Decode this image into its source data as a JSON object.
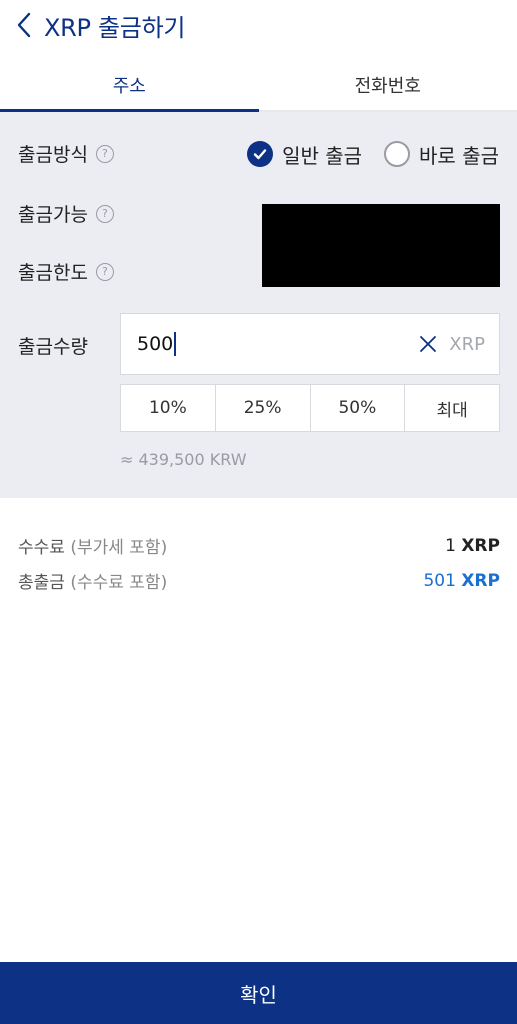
{
  "header": {
    "title": "XRP 출금하기"
  },
  "tabs": [
    {
      "label": "주소",
      "active": true
    },
    {
      "label": "전화번호",
      "active": false
    }
  ],
  "form": {
    "method_label": "출금방식",
    "options": [
      {
        "label": "일반 출금",
        "selected": true
      },
      {
        "label": "바로 출금",
        "selected": false
      }
    ],
    "available_label": "출금가능",
    "limit_label": "출금한도",
    "amount_label": "출금수량",
    "amount_value": "500",
    "amount_unit": "XRP",
    "percent_buttons": [
      "10%",
      "25%",
      "50%",
      "최대"
    ],
    "krw_estimate": "≈ 439,500 KRW"
  },
  "summary": {
    "fee_label": "수수료",
    "fee_sub": "(부가세 포함)",
    "fee_amount": "1",
    "fee_unit": "XRP",
    "total_label": "총출금",
    "total_sub": "(수수료 포함)",
    "total_amount": "501",
    "total_unit": "XRP"
  },
  "confirm_label": "확인",
  "colors": {
    "brand": "#0c3185",
    "panel_bg": "#ecedf2",
    "total_blue": "#1a6fd1"
  },
  "icons": {
    "back": "chevron-left-icon",
    "help": "question-circle-icon",
    "check": "checkmark-icon",
    "clear": "close-icon"
  }
}
